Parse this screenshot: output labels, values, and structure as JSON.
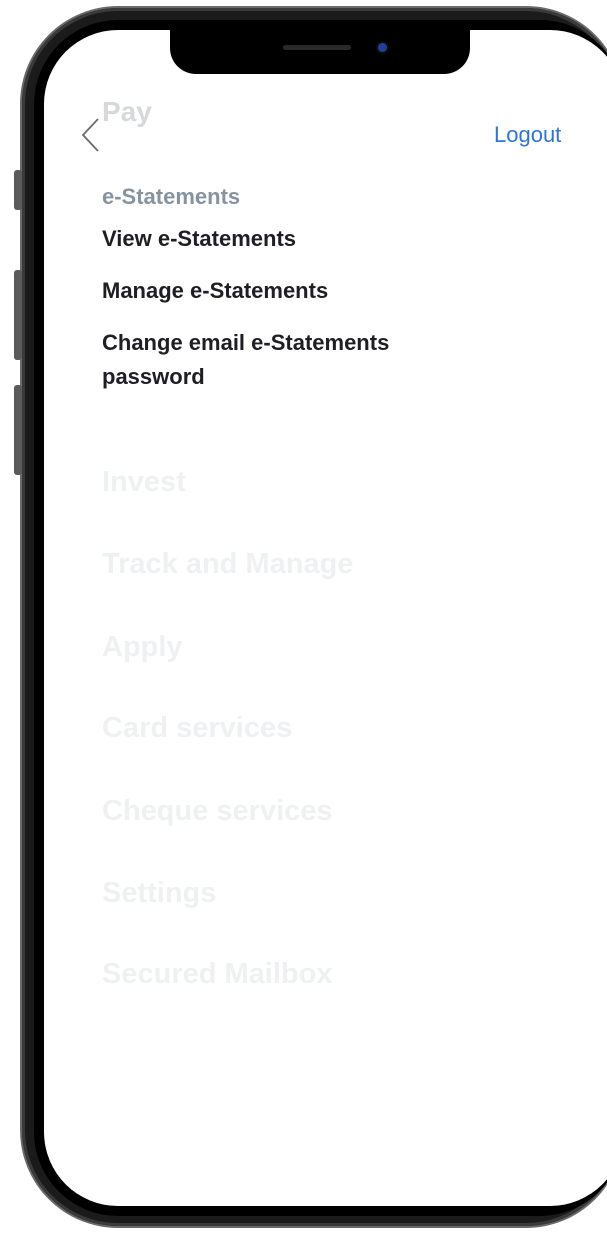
{
  "header": {
    "back_icon": "chevron-left-icon",
    "title": "Pay",
    "logout_label": "Logout"
  },
  "pay_section": {
    "label": "e-Statements",
    "items": [
      {
        "label": "View e-Statements"
      },
      {
        "label": "Manage e-Statements"
      },
      {
        "label": "Change email e-Statements password"
      }
    ]
  },
  "menu": {
    "items": [
      {
        "label": "Invest"
      },
      {
        "label": "Track and Manage"
      },
      {
        "label": "Apply"
      },
      {
        "label": "Card services"
      },
      {
        "label": "Cheque services"
      },
      {
        "label": "Settings"
      },
      {
        "label": "Secured Mailbox"
      }
    ]
  },
  "colors": {
    "accent": "#2f74d8",
    "section_label": "#8694a0",
    "text_primary": "#1e1e24",
    "text_faded": "#eef0f2"
  }
}
